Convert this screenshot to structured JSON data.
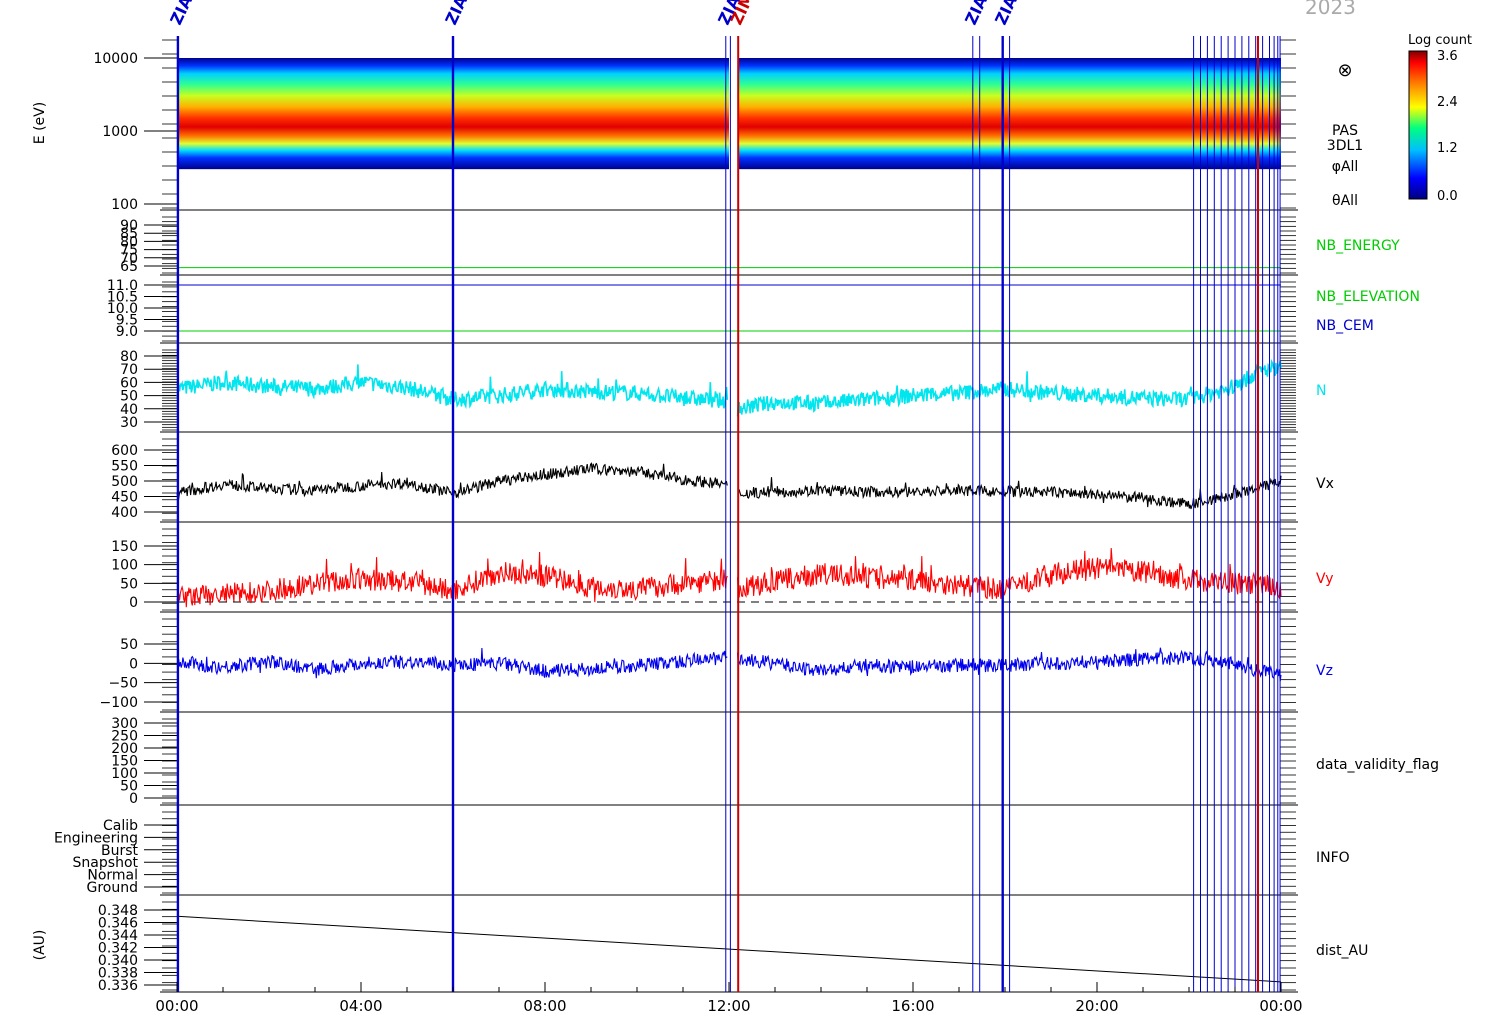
{
  "figure": {
    "header_year": "2023",
    "x_tick_labels": [
      "00:00",
      "04:00",
      "08:00",
      "12:00",
      "16:00",
      "20:00",
      "00:00"
    ],
    "x_range_hours": [
      0,
      24
    ],
    "event_marker_text": "ZIA",
    "event_marker_text_red": "ZIM"
  },
  "colorbar": {
    "title": "Log count",
    "ticks": [
      "3.6",
      "2.4",
      "1.2",
      "0.0"
    ],
    "range": [
      0.0,
      3.6
    ],
    "colors": [
      "#00007f",
      "#0000ff",
      "#00bfff",
      "#00ff7f",
      "#ffff00",
      "#ff7f00",
      "#ff0000",
      "#7f0000"
    ]
  },
  "events": {
    "blue_hours": [
      0.02,
      6.0,
      11.93,
      12.03,
      17.3,
      17.45,
      17.95,
      18.1,
      22.1,
      22.25,
      22.4,
      22.55,
      22.7,
      22.85,
      23.0,
      23.15,
      23.3,
      23.45,
      23.6,
      23.75,
      23.85,
      23.93,
      23.98
    ],
    "red_hours": [
      12.2,
      23.5
    ]
  },
  "chart_data": [
    {
      "id": "spectrogram",
      "type": "heatmap",
      "ylabel": "E (eV)",
      "yscale": "log",
      "ylim": [
        100,
        10000
      ],
      "ytick_labels": [
        "10000",
        "1000",
        "100"
      ],
      "right_labels": [
        "PAS",
        "3DL1",
        "φAll",
        "θAll"
      ],
      "right_symbol": "⊗",
      "data_range_eV": [
        300,
        10000
      ],
      "peak_energy_eV": 1100,
      "data_gap_hours": [
        12.0,
        12.2
      ]
    },
    {
      "id": "nb-energy",
      "type": "line",
      "ylim": [
        62,
        92
      ],
      "ytick_labels": [
        "90",
        "85",
        "80",
        "75",
        "70",
        "65"
      ],
      "series": [
        {
          "name": "NB_ENERGY",
          "color": "#00cc00",
          "value": 64
        }
      ]
    },
    {
      "id": "nb-elevation",
      "type": "line",
      "ylim": [
        8.8,
        11.1
      ],
      "ytick_labels": [
        "11.0",
        "10.5",
        "10.0",
        "9.5",
        "9.0"
      ],
      "series": [
        {
          "name": "NB_ELEVATION",
          "color": "#00cc00",
          "value": 9.0
        },
        {
          "name": "NB_CEM",
          "color": "#0000cc",
          "value": 11.0
        }
      ]
    },
    {
      "id": "density",
      "type": "line",
      "ylim": [
        25,
        85
      ],
      "ytick_labels": [
        "80",
        "70",
        "60",
        "50",
        "40",
        "30"
      ],
      "series": [
        {
          "name": "N",
          "color": "#00e5ee"
        }
      ],
      "x": [
        0,
        1,
        2,
        3,
        4,
        5,
        6,
        7,
        8,
        9,
        10,
        11,
        11.9,
        12.2,
        13,
        14,
        15,
        16,
        17,
        18,
        19,
        20,
        21,
        22,
        22.5,
        23,
        23.5,
        24
      ],
      "y": [
        55,
        60,
        57,
        55,
        60,
        56,
        47,
        50,
        55,
        53,
        52,
        48,
        46,
        40,
        45,
        44,
        47,
        50,
        52,
        55,
        52,
        50,
        48,
        47,
        52,
        57,
        68,
        72
      ]
    },
    {
      "id": "vx",
      "type": "line",
      "ylim": [
        375,
        625
      ],
      "ytick_labels": [
        "600",
        "550",
        "500",
        "450",
        "400"
      ],
      "series": [
        {
          "name": "Vx",
          "color": "#000000"
        }
      ],
      "x": [
        0,
        1,
        2,
        3,
        4,
        5,
        6,
        7,
        8,
        9,
        10,
        11,
        11.9,
        12.2,
        13,
        14,
        15,
        16,
        17,
        18,
        19,
        20,
        21,
        22,
        22.5,
        23,
        23.5,
        24
      ],
      "y": [
        460,
        490,
        475,
        470,
        485,
        495,
        460,
        500,
        520,
        540,
        530,
        505,
        490,
        460,
        465,
        470,
        465,
        465,
        470,
        465,
        465,
        455,
        445,
        425,
        440,
        455,
        475,
        500
      ]
    },
    {
      "id": "vy",
      "type": "line",
      "ylim": [
        -30,
        170
      ],
      "ytick_labels": [
        "150",
        "100",
        "50",
        "0"
      ],
      "series": [
        {
          "name": "Vy",
          "color": "#ff0000"
        }
      ],
      "x": [
        0,
        1,
        2,
        3,
        4,
        5,
        6,
        7,
        8,
        9,
        10,
        11,
        11.9,
        12.2,
        13,
        14,
        15,
        16,
        17,
        18,
        19,
        20,
        21,
        22,
        22.5,
        23,
        23.5,
        24
      ],
      "y": [
        10,
        20,
        30,
        50,
        60,
        55,
        30,
        80,
        70,
        40,
        35,
        50,
        60,
        35,
        55,
        75,
        65,
        60,
        45,
        35,
        75,
        90,
        80,
        60,
        55,
        50,
        45,
        40
      ]
    },
    {
      "id": "vz",
      "type": "line",
      "ylim": [
        -125,
        75
      ],
      "ytick_labels": [
        "50",
        "0",
        "−50",
        "−100"
      ],
      "series": [
        {
          "name": "Vz",
          "color": "#0000ee"
        }
      ],
      "x": [
        0,
        1,
        2,
        3,
        4,
        5,
        6,
        7,
        8,
        9,
        10,
        11,
        11.9,
        12.2,
        13,
        14,
        15,
        16,
        17,
        18,
        19,
        20,
        21,
        22,
        22.5,
        23,
        23.5,
        24
      ],
      "y": [
        0,
        -10,
        5,
        -15,
        0,
        5,
        -5,
        0,
        -20,
        -15,
        -5,
        5,
        15,
        10,
        0,
        -20,
        -5,
        -10,
        -5,
        -5,
        0,
        5,
        10,
        15,
        10,
        0,
        -20,
        -30
      ]
    },
    {
      "id": "data-validity",
      "type": "line",
      "ylim": [
        -20,
        310
      ],
      "ytick_labels": [
        "300",
        "250",
        "200",
        "150",
        "100",
        "50",
        "0"
      ],
      "series": [
        {
          "name": "data_validity_flag"
        }
      ]
    },
    {
      "id": "info",
      "type": "line",
      "category_labels": [
        "Calib",
        "Engineering",
        "Burst",
        "Snapshot",
        "Normal",
        "Ground"
      ],
      "series": [
        {
          "name": "INFO"
        }
      ]
    },
    {
      "id": "distance",
      "type": "line",
      "ylabel": "(AU)",
      "ylim": [
        0.3355,
        0.3485
      ],
      "ytick_labels": [
        "0.348",
        "0.346",
        "0.344",
        "0.342",
        "0.340",
        "0.338",
        "0.336"
      ],
      "series": [
        {
          "name": "dist_AU",
          "color": "#000000"
        }
      ],
      "x": [
        0,
        24
      ],
      "y": [
        0.347,
        0.3365
      ]
    }
  ]
}
